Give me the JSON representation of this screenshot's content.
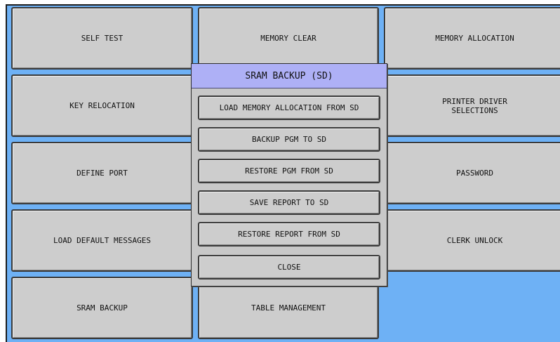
{
  "menu": {
    "self_test": "SELF TEST",
    "memory_clear": "MEMORY CLEAR",
    "memory_allocation": "MEMORY ALLOCATION",
    "key_relocation": "KEY RELOCATION",
    "printer_driver": "PRINTER DRIVER\nSELECTIONS",
    "define_port": "DEFINE PORT",
    "password": "PASSWORD",
    "load_default_messages": "LOAD DEFAULT MESSAGES",
    "clerk_unlock": "CLERK UNLOCK",
    "sram_backup": "SRAM BACKUP",
    "table_management": "TABLE MANAGEMENT"
  },
  "dialog": {
    "title": "SRAM BACKUP (SD)",
    "buttons": [
      "LOAD MEMORY ALLOCATION FROM SD",
      "BACKUP PGM TO SD",
      "RESTORE PGM FROM SD",
      "SAVE REPORT TO SD",
      "RESTORE REPORT FROM SD",
      "CLOSE"
    ]
  },
  "colors": {
    "background": "#6eb1f5",
    "tile": "#cdcdcd",
    "dialog_title": "#aeb0f6"
  }
}
